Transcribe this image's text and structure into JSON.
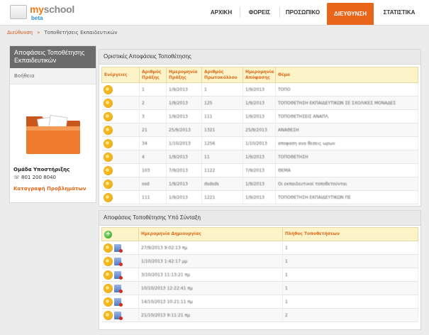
{
  "brand": {
    "name_part1": "my",
    "name_part2": "school",
    "tag": "beta"
  },
  "nav": {
    "items": [
      {
        "label": "ΑΡΧΙΚΗ",
        "active": false
      },
      {
        "label": "ΦΟΡΕΙΣ",
        "active": false
      },
      {
        "label": "ΠΡΟΣΩΠΙΚΟ",
        "active": false
      },
      {
        "label": "ΔΙΕΥΘΥΝΣΗ",
        "active": true
      },
      {
        "label": "ΣΤΑΤΙΣΤΙΚΑ",
        "active": false
      }
    ]
  },
  "breadcrumb": {
    "parent": "Διεύθυνση",
    "separator": "»",
    "current": "Τοποθετήσεις Εκπαιδευτικών"
  },
  "sidebar": {
    "title": "Αποφάσεις Τοποθέτησης Εκπαιδευτικών",
    "help": "Βοήθεια",
    "support_title": "Ομάδα Υποστήριξης",
    "phone": "801 200 8040",
    "report_link": "Καταγραφή Προβλημάτων"
  },
  "final_decisions": {
    "title": "Οριστικές Αποφάσεις Τοποθέτησης",
    "headers": [
      "Ενέργειες",
      "Αριθμός Πράξης",
      "Ημερομηνία Πράξης",
      "Αριθμός Πρωτοκόλλου",
      "Ημερομηνία Απόφασης",
      "Θέμα"
    ],
    "rows": [
      [
        "1",
        "1/9/2013",
        "1",
        "1/9/2013",
        "ΤΟΠΟ"
      ],
      [
        "2",
        "1/9/2013",
        "125",
        "1/9/2013",
        "ΤΟΠΟΘΕΤΗΣΗ ΕΚΠΑΙΔΕΥΤΙΚΩΝ ΣΕ ΣΧΟΛΙΚΕΣ ΜΟΝΑΔΕΣ"
      ],
      [
        "3",
        "1/9/2013",
        "111",
        "1/9/2013",
        "ΤΟΠΟΘΕΤΗΣΕΙΣ ΑΝΑΠΛ."
      ],
      [
        "21",
        "25/9/2013",
        "1321",
        "25/9/2013",
        "ΑΝΑΘΕΣΗ"
      ],
      [
        "34",
        "1/10/2013",
        "1256",
        "1/10/2013",
        "αποφαση ανα θεσεις ωρων"
      ],
      [
        "4",
        "1/9/2013",
        "11",
        "1/9/2013",
        "ΤΟΠΟΘΕΤΗΣΗ"
      ],
      [
        "103",
        "7/9/2013",
        "1122",
        "7/9/2013",
        "ΘΕΜΑ"
      ],
      [
        "osd",
        "1/9/2013",
        "dsdsds",
        "1/9/2013",
        "Οι εκπαιδευτικοί τοποθετούνται"
      ],
      [
        "111",
        "1/9/2013",
        "1221",
        "1/9/2013",
        "ΤΟΠΟΘΕΤΗΣΗ ΕΚΠΑΙΔΕΥΤΙΚΩΝ ΠΕ"
      ]
    ]
  },
  "draft_decisions": {
    "title": "Αποφάσεις Τοποθέτησης Υπό Σύνταξη",
    "headers": [
      "",
      "Ημερομηνία Δημιουργίας",
      "Πλήθος Τοποθετήσεων"
    ],
    "add_symbol": "+",
    "rows": [
      [
        "27/9/2013 9:02:13 πμ",
        "1"
      ],
      [
        "1/10/2013 1:42:17 μμ",
        "1"
      ],
      [
        "3/10/2013 11:13:21 πμ",
        "1"
      ],
      [
        "10/10/2013 12:22:41 πμ",
        "1"
      ],
      [
        "14/10/2013 10:21:11 πμ",
        "1"
      ],
      [
        "21/10/2013 9:11:21 πμ",
        "2"
      ]
    ]
  },
  "colors": {
    "accent": "#e8651a",
    "header_bg": "#fdf3c8",
    "sidebar_head": "#6b6b6b"
  }
}
